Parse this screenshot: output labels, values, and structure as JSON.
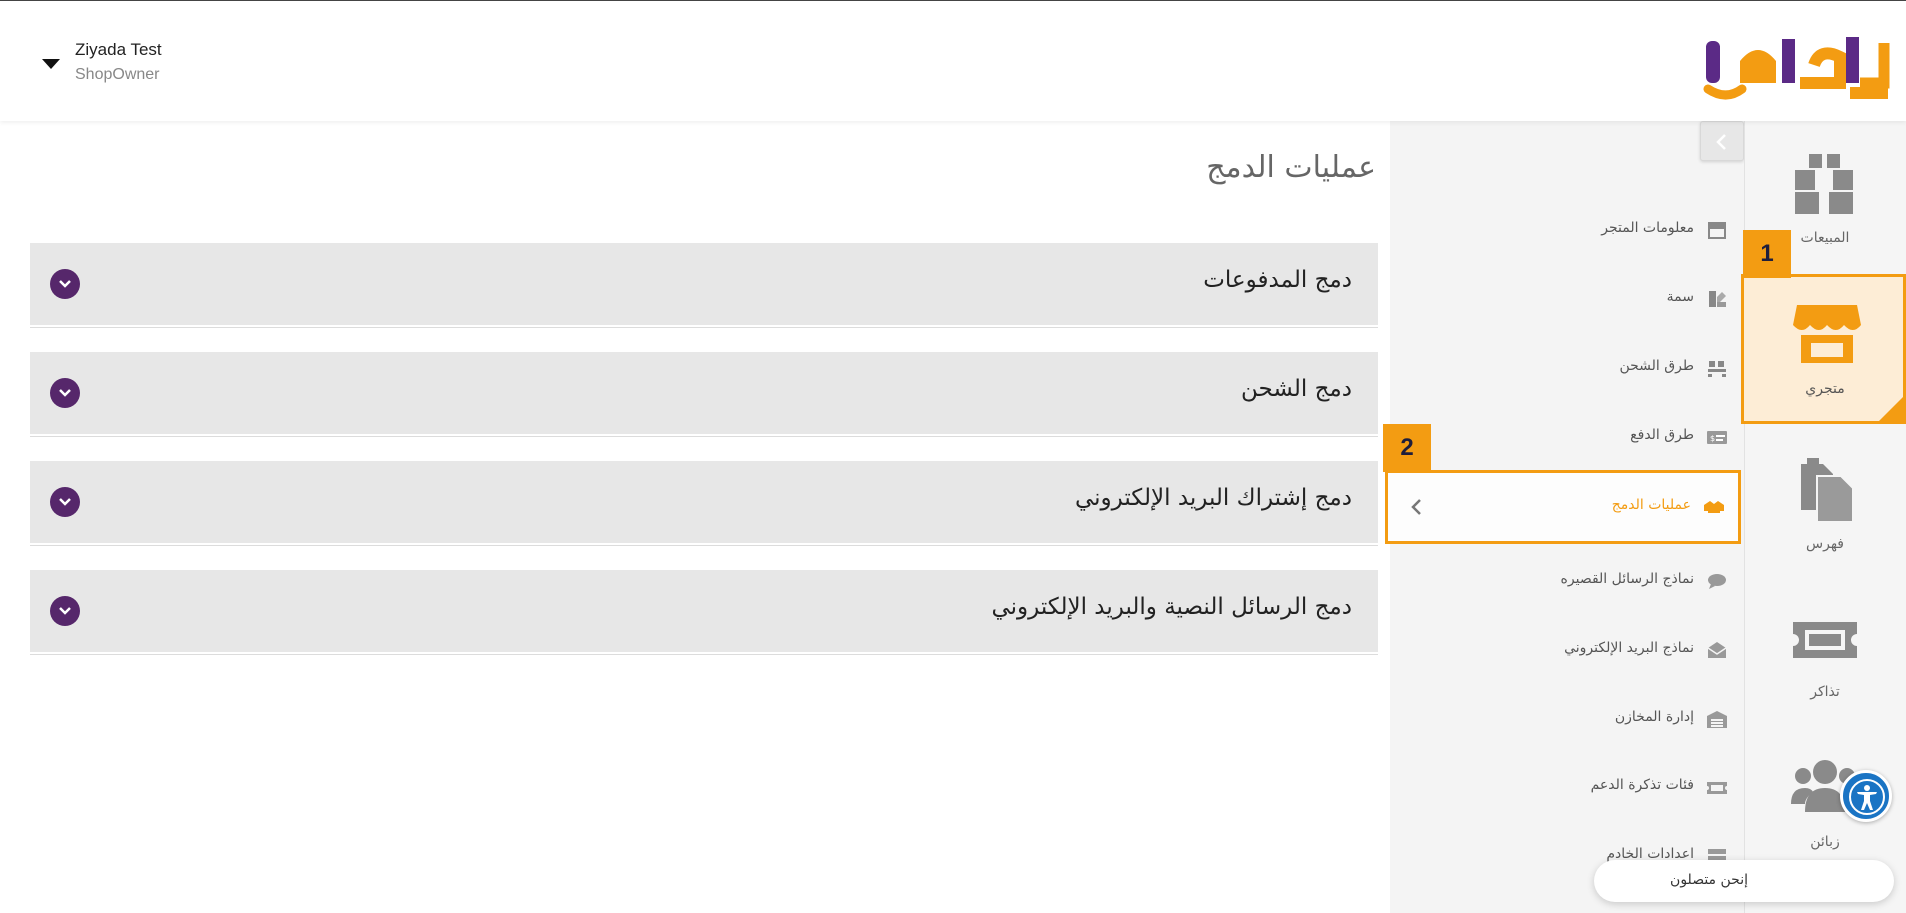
{
  "header": {
    "user_name": "Ziyada Test",
    "user_role": "ShopOwner",
    "logo_text": "كليفا"
  },
  "rail": {
    "items": [
      {
        "label": "المبيعات",
        "icon": "boxes-icon"
      },
      {
        "label": "متجري",
        "icon": "store-icon",
        "active": true
      },
      {
        "label": "فهرس",
        "icon": "files-icon"
      },
      {
        "label": "تذاكر",
        "icon": "ticket-icon"
      },
      {
        "label": "زبائن",
        "icon": "users-icon"
      }
    ]
  },
  "menu": {
    "items": [
      {
        "label": "معلومات المتجر",
        "icon": "storefront-icon"
      },
      {
        "label": "سمة",
        "icon": "palette-icon"
      },
      {
        "label": "طرق الشحن",
        "icon": "pallet-icon"
      },
      {
        "label": "طرق الدفع",
        "icon": "money-icon"
      },
      {
        "label": "عمليات الدمج",
        "icon": "handshake-icon",
        "active": true
      },
      {
        "label": "نماذج الرسائل القصيره",
        "icon": "sms-icon"
      },
      {
        "label": "نماذج البريد الإلكتروني",
        "icon": "envelope-icon"
      },
      {
        "label": "إدارة المخازن",
        "icon": "warehouse-icon"
      },
      {
        "label": "فئات تذكرة الدعم",
        "icon": "ticket-icon"
      },
      {
        "label": "اعدادات الخادم",
        "icon": "server-icon"
      }
    ]
  },
  "badges": {
    "one": "1",
    "two": "2"
  },
  "main": {
    "title": "عمليات الدمج",
    "sections": [
      {
        "title": "دمج المدفوعات"
      },
      {
        "title": "دمج الشحن"
      },
      {
        "title": "دمج إشتراك البريد الإلكتروني"
      },
      {
        "title": "دمج الرسائل النصية والبريد الإلكتروني"
      }
    ]
  },
  "chat": {
    "label": "إنحن متصلون"
  },
  "colors": {
    "accent": "#f39c12",
    "brand_purple": "#56276b",
    "panel_bg": "#f4f4f4",
    "accordion_bg": "#e7e7e7"
  }
}
